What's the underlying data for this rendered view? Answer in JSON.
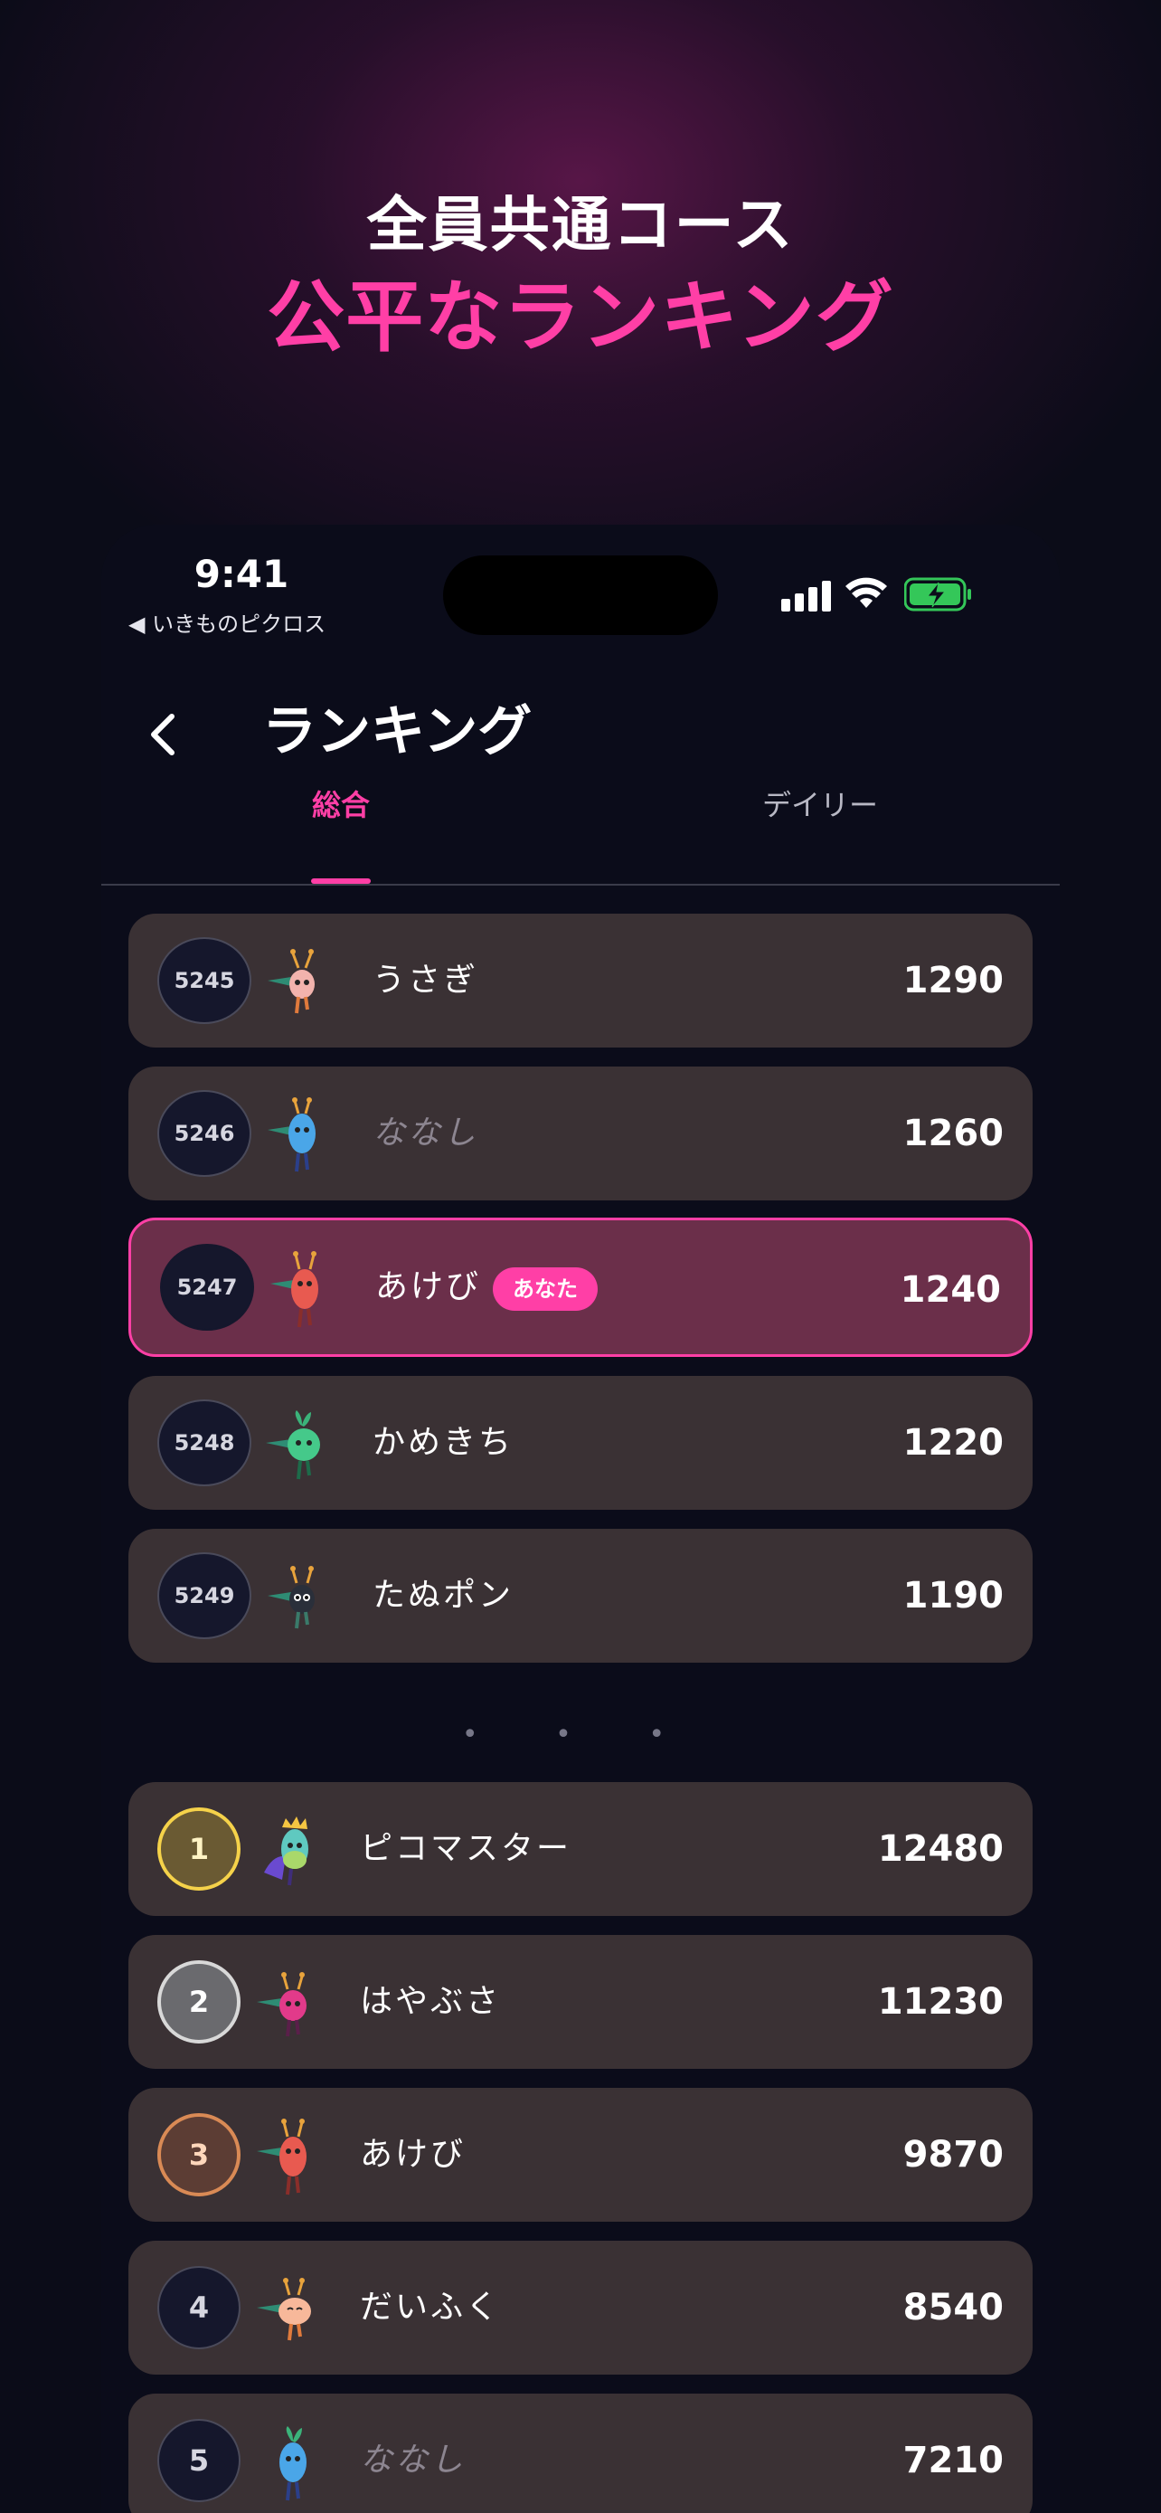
{
  "promo": {
    "line1": "全員共通コース",
    "line2": "公平なランキング"
  },
  "status_bar": {
    "time": "9:41",
    "back_app": "◀ いきものピクロス",
    "battery_color": "#34c759"
  },
  "nav": {
    "title": "ランキング",
    "back_icon": "chevron-left-icon"
  },
  "tabs": [
    {
      "label": "総合",
      "active": true
    },
    {
      "label": "デイリー",
      "active": false
    }
  ],
  "nearby_ranking": [
    {
      "rank": "5245",
      "name": "うさぎ",
      "score": "1290",
      "avatar": "pink-sprout-creature-icon"
    },
    {
      "rank": "5246",
      "name": "ななし",
      "score": "1260",
      "anon": true,
      "avatar": "blue-drop-creature-icon"
    },
    {
      "rank": "5247",
      "name": "あけび",
      "score": "1240",
      "you_label": "あなた",
      "is_me": true,
      "avatar": "red-creature-icon"
    },
    {
      "rank": "5248",
      "name": "かめきち",
      "score": "1220",
      "avatar": "green-creature-icon"
    },
    {
      "rank": "5249",
      "name": "たぬポン",
      "score": "1190",
      "avatar": "dark-creature-icon"
    }
  ],
  "separator": "• • •",
  "top_ranking": [
    {
      "rank": "1",
      "name": "ピコマスター",
      "score": "12480",
      "medal": "gold",
      "avatar": "crowned-rainbow-creature-icon"
    },
    {
      "rank": "2",
      "name": "はやぶさ",
      "score": "11230",
      "medal": "silver",
      "avatar": "magenta-creature-icon"
    },
    {
      "rank": "3",
      "name": "あけび",
      "score": "9870",
      "medal": "bronze",
      "avatar": "red-creature-icon"
    },
    {
      "rank": "4",
      "name": "だいふく",
      "score": "8540",
      "avatar": "peach-creature-icon"
    },
    {
      "rank": "5",
      "name": "ななし",
      "score": "7210",
      "anon": true,
      "avatar": "blue-drop-creature-icon"
    }
  ],
  "colors": {
    "accent": "#ff3fa6",
    "row_bg": "#3a3134",
    "me_row_bg": "#6b2f4a",
    "page_bg": "#0b0c18"
  }
}
